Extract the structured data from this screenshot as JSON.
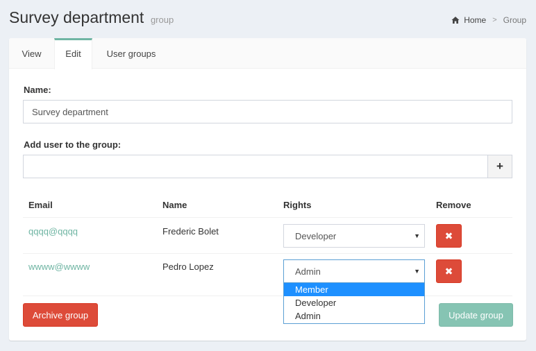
{
  "header": {
    "title": "Survey department",
    "subtitle": "group",
    "breadcrumb": {
      "home": "Home",
      "separator": ">",
      "current": "Group"
    }
  },
  "tabs": [
    {
      "label": "View",
      "active": false
    },
    {
      "label": "Edit",
      "active": true
    },
    {
      "label": "User groups",
      "active": false
    }
  ],
  "form": {
    "name_label": "Name:",
    "name_value": "Survey department",
    "add_user_label": "Add user to the group:",
    "add_user_value": "",
    "add_button": "+"
  },
  "table": {
    "headers": {
      "email": "Email",
      "name": "Name",
      "rights": "Rights",
      "remove": "Remove"
    },
    "rows": [
      {
        "email": "qqqq@qqqq",
        "name": "Frederic Bolet",
        "rights": "Developer",
        "remove": "✖"
      },
      {
        "email": "wwww@wwww",
        "name": "Pedro Lopez",
        "rights": "Admin",
        "remove": "✖"
      }
    ]
  },
  "dropdown": {
    "options": [
      "Member",
      "Developer",
      "Admin"
    ],
    "highlighted": "Member"
  },
  "actions": {
    "archive": "Archive group",
    "update": "Update group"
  },
  "colors": {
    "accent": "#6fb5a3",
    "danger": "#dd4b39",
    "highlight": "#1e90ff"
  },
  "icons": {
    "home": "home-icon",
    "remove": "times-icon",
    "caret": "caret-down-icon"
  }
}
